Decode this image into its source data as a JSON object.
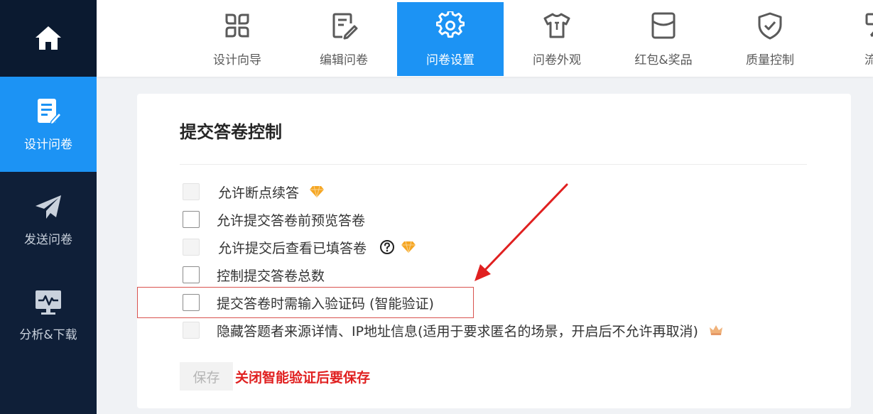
{
  "sidebar": {
    "home_icon": "home-icon",
    "items": [
      {
        "label": "设计问卷",
        "icon": "edit-doc-icon",
        "active": true
      },
      {
        "label": "发送问卷",
        "icon": "send-icon",
        "active": false
      },
      {
        "label": "分析&下载",
        "icon": "analytics-icon",
        "active": false
      }
    ]
  },
  "topnav": {
    "tabs": [
      {
        "label": "设计向导",
        "icon": "grid-icon"
      },
      {
        "label": "编辑问卷",
        "icon": "edit-icon"
      },
      {
        "label": "问卷设置",
        "icon": "gear-icon",
        "active": true
      },
      {
        "label": "问卷外观",
        "icon": "shirt-icon"
      },
      {
        "label": "红包&奖品",
        "icon": "envelope-icon"
      },
      {
        "label": "质量控制",
        "icon": "shield-check-icon"
      },
      {
        "label": "流程",
        "icon": "flow-icon"
      }
    ]
  },
  "card": {
    "title": "提交答卷控制",
    "options": [
      {
        "label": "允许断点续答",
        "checked": false,
        "disabled": true,
        "badge": "diamond-icon"
      },
      {
        "label": "允许提交答卷前预览答卷",
        "checked": false,
        "disabled": false
      },
      {
        "label": "允许提交后查看已填答卷",
        "checked": false,
        "disabled": true,
        "help": "help-circle-icon",
        "badge": "diamond-icon"
      },
      {
        "label": "控制提交答卷总数",
        "checked": false,
        "disabled": false
      },
      {
        "label": "提交答卷时需输入验证码 (智能验证)",
        "checked": false,
        "disabled": false,
        "highlighted": true
      },
      {
        "label": "隐藏答题者来源详情、IP地址信息(适用于要求匿名的场景，开启后不允许再取消)",
        "checked": false,
        "disabled": true,
        "badge": "crown-icon"
      }
    ],
    "save_label": "保存",
    "save_note": "关闭智能验证后要保存"
  },
  "colors": {
    "accent": "#1c93f4",
    "sidebar_bg": "#0f1f38",
    "annotation_red": "#e02020",
    "diamond": "#f5a623"
  }
}
